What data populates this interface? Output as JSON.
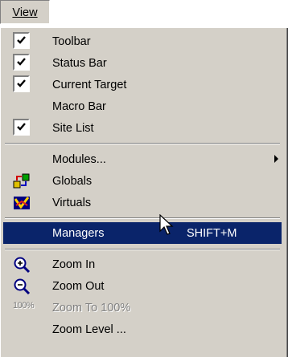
{
  "menubar": {
    "title": "View"
  },
  "menu": {
    "items": [
      {
        "label": "Toolbar",
        "checked": true
      },
      {
        "label": "Status Bar",
        "checked": true
      },
      {
        "label": "Current Target",
        "checked": true
      },
      {
        "label": "Macro Bar",
        "checked": false
      },
      {
        "label": "Site List",
        "checked": true
      },
      {
        "label": "Modules...",
        "has_submenu": true
      },
      {
        "label": "Globals",
        "icon": "globals-icon"
      },
      {
        "label": "Virtuals",
        "icon": "virtuals-icon"
      },
      {
        "label": "Managers",
        "shortcut": "SHIFT+M",
        "highlighted": true
      },
      {
        "label": "Zoom In",
        "icon": "zoom-in-icon"
      },
      {
        "label": "Zoom Out",
        "icon": "zoom-out-icon"
      },
      {
        "label": "Zoom To 100%",
        "icon_text": "100%",
        "disabled": true
      },
      {
        "label": "Zoom Level ..."
      }
    ]
  },
  "colors": {
    "menu_bg": "#d4d0c8",
    "highlight_bg": "#0a246a",
    "highlight_text": "#ffffff",
    "disabled_text": "#808080"
  }
}
